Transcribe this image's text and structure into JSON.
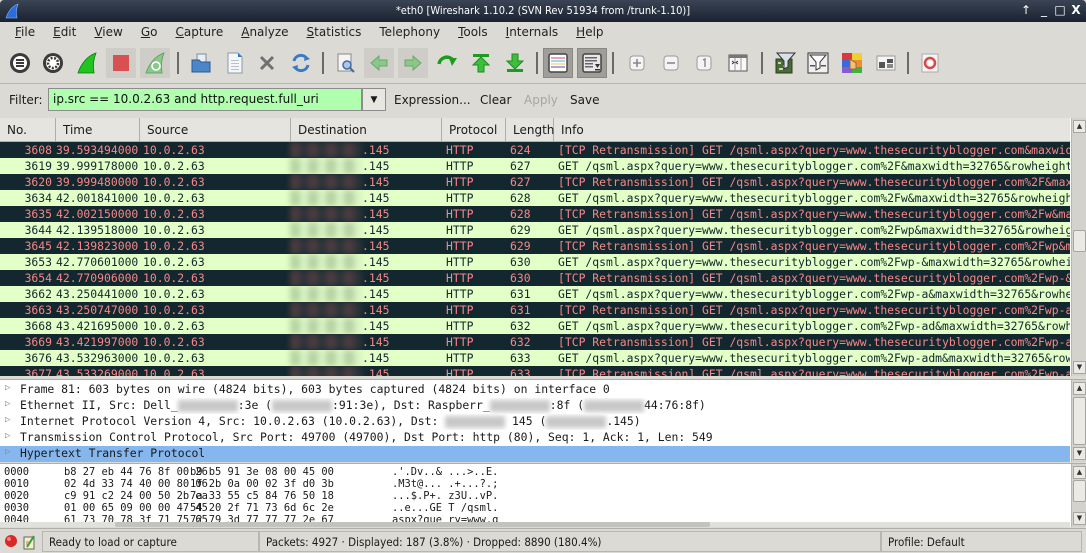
{
  "window": {
    "title": "*eth0  [Wireshark 1.10.2  (SVN Rev 51934 from /trunk-1.10)]",
    "controls": {
      "pin": "↑",
      "minimize": "_",
      "maximize": "□",
      "close": "X"
    }
  },
  "menubar": {
    "items": [
      {
        "label": "File",
        "accel": "F",
        "rest": "ile"
      },
      {
        "label": "Edit",
        "accel": "E",
        "rest": "dit"
      },
      {
        "label": "View",
        "accel": "V",
        "rest": "iew"
      },
      {
        "label": "Go",
        "accel": "G",
        "rest": "o"
      },
      {
        "label": "Capture",
        "accel": "C",
        "rest": "apture"
      },
      {
        "label": "Analyze",
        "accel": "A",
        "rest": "nalyze"
      },
      {
        "label": "Statistics",
        "accel": "S",
        "rest": "tatistics"
      },
      {
        "label": "Telephony",
        "accel": "",
        "rest": "Telephony"
      },
      {
        "label": "Tools",
        "accel": "T",
        "rest": "ools"
      },
      {
        "label": "Internals",
        "accel": "I",
        "rest": "nternals"
      },
      {
        "label": "Help",
        "accel": "H",
        "rest": "elp"
      }
    ]
  },
  "toolbar": {
    "buttons": [
      {
        "name": "interfaces-list-icon"
      },
      {
        "name": "capture-options-icon"
      },
      {
        "name": "start-capture-icon"
      },
      {
        "name": "stop-capture-icon"
      },
      {
        "name": "restart-capture-icon"
      },
      {
        "name": "open-file-icon"
      },
      {
        "name": "save-file-icon"
      },
      {
        "name": "close-file-icon"
      },
      {
        "name": "reload-icon"
      },
      {
        "name": "find-packet-icon"
      },
      {
        "name": "go-back-icon"
      },
      {
        "name": "go-forward-icon"
      },
      {
        "name": "go-to-packet-icon"
      },
      {
        "name": "go-first-icon"
      },
      {
        "name": "go-last-icon"
      },
      {
        "name": "colorize-icon"
      },
      {
        "name": "auto-scroll-icon"
      },
      {
        "name": "zoom-in-icon"
      },
      {
        "name": "zoom-out-icon"
      },
      {
        "name": "normal-size-icon"
      },
      {
        "name": "resize-columns-icon"
      },
      {
        "name": "capture-filters-icon"
      },
      {
        "name": "display-filters-icon"
      },
      {
        "name": "coloring-rules-icon"
      },
      {
        "name": "preferences-icon"
      },
      {
        "name": "help-icon"
      }
    ]
  },
  "filter": {
    "label": "Filter:",
    "value": "ip.src == 10.0.2.63 and http.request.full_uri",
    "expression_label": "Expression...",
    "clear_label": "Clear",
    "apply_label": "Apply",
    "save_label": "Save",
    "valid_color": "#afffaf"
  },
  "packet_list": {
    "columns": [
      "No.",
      "Time",
      "Source",
      "Destination",
      "Protocol",
      "Length",
      "Info"
    ],
    "rows": [
      {
        "no": "3608",
        "time": "39.593494000",
        "src": "10.0.2.63",
        "dst": ".145",
        "proto": "HTTP",
        "len": "624",
        "info": "[TCP Retransmission] GET /qsml.aspx?query=www.thesecurityblogger.com&maxwid",
        "style": "retx"
      },
      {
        "no": "3619",
        "time": "39.999178000",
        "src": "10.0.2.63",
        "dst": ".145",
        "proto": "HTTP",
        "len": "627",
        "info": "GET /qsml.aspx?query=www.thesecurityblogger.com%2F&maxwidth=32765&rowheight",
        "style": "ok"
      },
      {
        "no": "3620",
        "time": "39.999480000",
        "src": "10.0.2.63",
        "dst": ".145",
        "proto": "HTTP",
        "len": "627",
        "info": "[TCP Retransmission] GET /qsml.aspx?query=www.thesecurityblogger.com%2F&max",
        "style": "retx"
      },
      {
        "no": "3634",
        "time": "42.001841000",
        "src": "10.0.2.63",
        "dst": ".145",
        "proto": "HTTP",
        "len": "628",
        "info": "GET /qsml.aspx?query=www.thesecurityblogger.com%2Fw&maxwidth=32765&rowheigh",
        "style": "ok"
      },
      {
        "no": "3635",
        "time": "42.002150000",
        "src": "10.0.2.63",
        "dst": ".145",
        "proto": "HTTP",
        "len": "628",
        "info": "[TCP Retransmission] GET /qsml.aspx?query=www.thesecurityblogger.com%2Fw&ma",
        "style": "retx"
      },
      {
        "no": "3644",
        "time": "42.139518000",
        "src": "10.0.2.63",
        "dst": ".145",
        "proto": "HTTP",
        "len": "629",
        "info": "GET /qsml.aspx?query=www.thesecurityblogger.com%2Fwp&maxwidth=32765&rowheig",
        "style": "ok"
      },
      {
        "no": "3645",
        "time": "42.139823000",
        "src": "10.0.2.63",
        "dst": ".145",
        "proto": "HTTP",
        "len": "629",
        "info": "[TCP Retransmission] GET /qsml.aspx?query=www.thesecurityblogger.com%2Fwp&m",
        "style": "retx"
      },
      {
        "no": "3653",
        "time": "42.770601000",
        "src": "10.0.2.63",
        "dst": ".145",
        "proto": "HTTP",
        "len": "630",
        "info": "GET /qsml.aspx?query=www.thesecurityblogger.com%2Fwp-&maxwidth=32765&rowhei",
        "style": "ok"
      },
      {
        "no": "3654",
        "time": "42.770906000",
        "src": "10.0.2.63",
        "dst": ".145",
        "proto": "HTTP",
        "len": "630",
        "info": "[TCP Retransmission] GET /qsml.aspx?query=www.thesecurityblogger.com%2Fwp-&",
        "style": "retx"
      },
      {
        "no": "3662",
        "time": "43.250441000",
        "src": "10.0.2.63",
        "dst": ".145",
        "proto": "HTTP",
        "len": "631",
        "info": "GET /qsml.aspx?query=www.thesecurityblogger.com%2Fwp-a&maxwidth=32765&rowhe",
        "style": "ok"
      },
      {
        "no": "3663",
        "time": "43.250747000",
        "src": "10.0.2.63",
        "dst": ".145",
        "proto": "HTTP",
        "len": "631",
        "info": "[TCP Retransmission] GET /qsml.aspx?query=www.thesecurityblogger.com%2Fwp-a",
        "style": "retx"
      },
      {
        "no": "3668",
        "time": "43.421695000",
        "src": "10.0.2.63",
        "dst": ".145",
        "proto": "HTTP",
        "len": "632",
        "info": "GET /qsml.aspx?query=www.thesecurityblogger.com%2Fwp-ad&maxwidth=32765&rowh",
        "style": "ok"
      },
      {
        "no": "3669",
        "time": "43.421997000",
        "src": "10.0.2.63",
        "dst": ".145",
        "proto": "HTTP",
        "len": "632",
        "info": "[TCP Retransmission] GET /qsml.aspx?query=www.thesecurityblogger.com%2Fwp-a",
        "style": "retx"
      },
      {
        "no": "3676",
        "time": "43.532963000",
        "src": "10.0.2.63",
        "dst": ".145",
        "proto": "HTTP",
        "len": "633",
        "info": "GET /qsml.aspx?query=www.thesecurityblogger.com%2Fwp-adm&maxwidth=32765&row",
        "style": "ok"
      },
      {
        "no": "3677",
        "time": "43.533269000",
        "src": "10.0.2.63",
        "dst": ".145",
        "proto": "HTTP",
        "len": "633",
        "info": "[TCP Retransmission] GET /qsml.aspx?query=www.thesecurityblogger.com%2Fwp-a",
        "style": "retx"
      }
    ]
  },
  "details": {
    "rows": [
      {
        "parts": [
          "Frame 81: 603 bytes on wire (4824 bits), 603 bytes captured (4824 bits) on interface 0"
        ]
      },
      {
        "parts": [
          "Ethernet II, Src: Dell_",
          "BLUR",
          ":3e (",
          "BLUR",
          ":91:3e), Dst: Raspberr_",
          "BLUR",
          ":8f (",
          "BLUR",
          "44:76:8f)"
        ]
      },
      {
        "parts": [
          "Internet Protocol Version 4, Src: 10.0.2.63 (10.0.2.63), Dst: ",
          "BLUR",
          " 145 (",
          "BLUR",
          ".145)"
        ]
      },
      {
        "parts": [
          "Transmission Control Protocol, Src Port: 49700 (49700), Dst Port: http (80), Seq: 1, Ack: 1, Len: 549"
        ]
      },
      {
        "parts": [
          "Hypertext Transfer Protocol"
        ],
        "selected": true
      }
    ]
  },
  "hex": {
    "rows": [
      {
        "off": "0000",
        "b1": "b8 27 eb 44 76 8f 00 26",
        "b2": "b9 b5 91 3e 08 00 45 00",
        "ascii": ".'.Dv..& ...>..E."
      },
      {
        "off": "0010",
        "b1": "02 4d 33 74 40 00 80 06",
        "b2": "1f 2b 0a 00 02 3f d0 3b",
        "ascii": ".M3t@... .+...?.;"
      },
      {
        "off": "0020",
        "b1": "c9 91 c2 24 00 50 2b ea",
        "b2": "7a 33 55 c5 84 76 50 18",
        "ascii": "...$.P+. z3U..vP."
      },
      {
        "off": "0030",
        "b1": "01 00 65 09 00 00 47 45",
        "b2": "54 20 2f 71 73 6d 6c 2e",
        "ascii": "..e...GE T /qsml."
      },
      {
        "off": "0040",
        "b1": "61 73 70 78 3f 71 75 65",
        "b2": "72 79 3d 77 77 77 2e 67",
        "ascii": "aspx?que ry=www.g"
      }
    ]
  },
  "statusbar": {
    "status": "Ready to load or capture",
    "stats": "Packets: 4927 · Displayed: 187 (3.8%)  · Dropped: 8890 (180.4%)",
    "profile": "Profile: Default"
  },
  "colors": {
    "normal_row_bg": "#e4ffc7",
    "normal_row_fg": "#12272e",
    "retx_row_bg": "#12272e",
    "retx_row_fg": "#f78787",
    "selected_detail_bg": "#86b6ee"
  }
}
